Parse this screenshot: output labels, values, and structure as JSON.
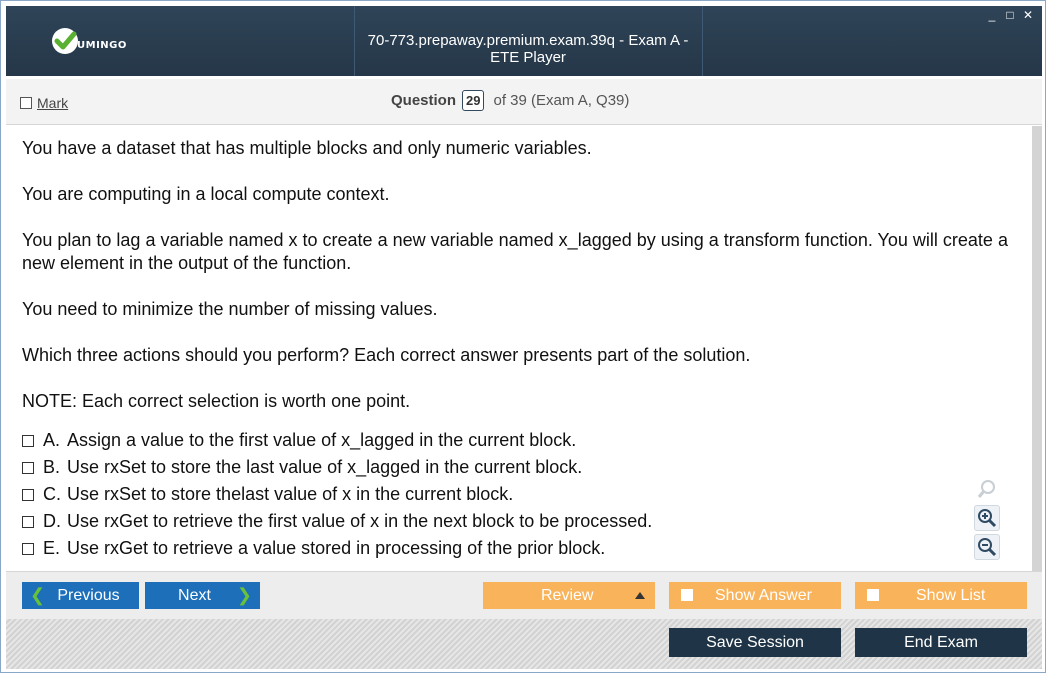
{
  "titlebar": {
    "logo_text": "UMINGO",
    "window_title": "70-773.prepaway.premium.exam.39q - Exam A - ETE Player",
    "controls": [
      "_",
      "□",
      "✕"
    ]
  },
  "question_header": {
    "mark_label": "Mark",
    "question_label": "Question",
    "question_number": "29",
    "of_text": "of 39 (Exam A, Q39)"
  },
  "question": {
    "paragraphs": [
      "You have a dataset that has multiple blocks and only numeric variables.",
      "You are computing in a local compute context.",
      "You plan to lag a variable named x to create a new variable named x_lagged by using a transform function. You will create a new element in the output of the function.",
      "You need to minimize the number of missing values.",
      "Which three actions should you perform? Each correct answer presents part of the solution.",
      "NOTE: Each correct selection is worth one point."
    ],
    "answers": [
      {
        "letter": "A.",
        "text": "Assign a value to the first value of x_lagged in the current block."
      },
      {
        "letter": "B.",
        "text": "Use rxSet to store the last value of x_lagged in the current block."
      },
      {
        "letter": "C.",
        "text": "Use rxSet to store thelast value of x in the current block."
      },
      {
        "letter": "D.",
        "text": "Use rxGet to retrieve the first value of x in the next block to be processed."
      },
      {
        "letter": "E.",
        "text": "Use rxGet to retrieve a value stored in processing of the prior block."
      }
    ]
  },
  "nav": {
    "previous_label": "Previous",
    "next_label": "Next",
    "review_label": "Review",
    "show_answer_label": "Show Answer",
    "show_list_label": "Show List"
  },
  "footer": {
    "save_session_label": "Save Session",
    "end_exam_label": "End Exam"
  },
  "icons": {
    "zoom": [
      "zoom-reset-icon",
      "zoom-in-icon",
      "zoom-out-icon"
    ]
  },
  "colors": {
    "titlebar": "#2a3e50",
    "nav_blue": "#1c6fb8",
    "nav_orange": "#f9b35a",
    "footer_dark": "#1f3547",
    "logo_green": "#5ab031"
  }
}
